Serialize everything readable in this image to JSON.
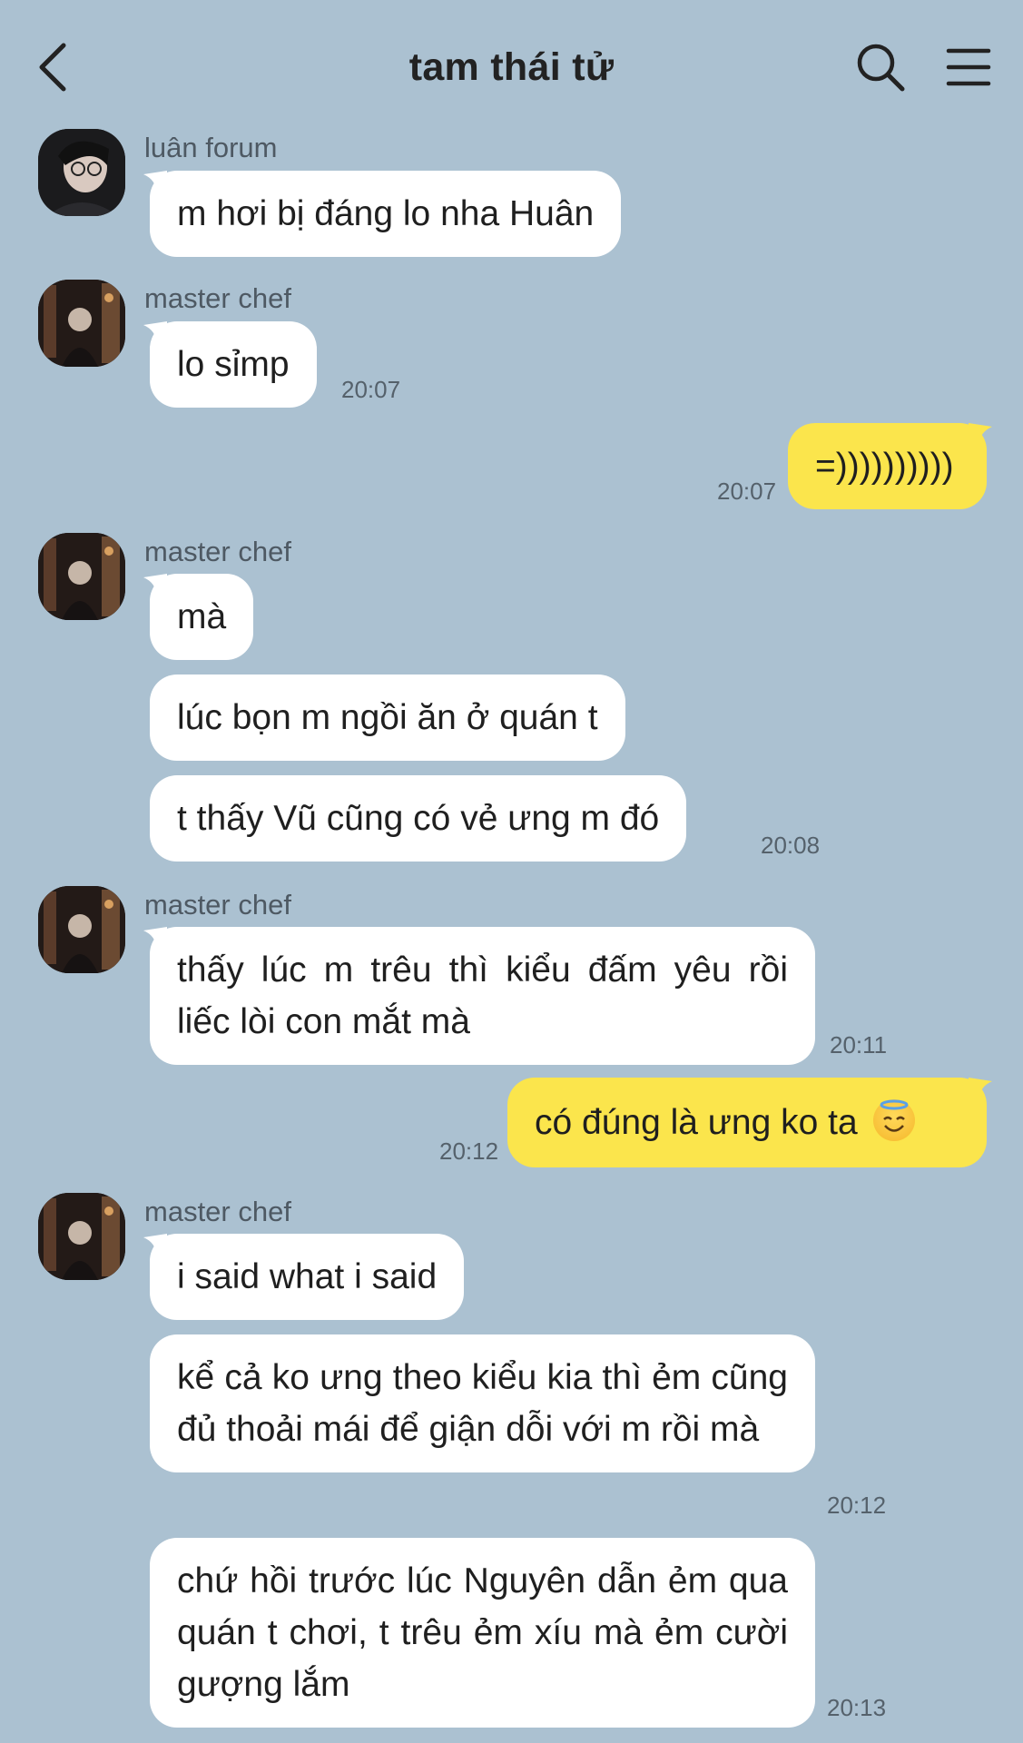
{
  "header": {
    "title": "tam thái tử",
    "back_icon": "chevron-left-icon",
    "search_icon": "search-icon",
    "menu_icon": "hamburger-menu-icon"
  },
  "colors": {
    "background": "#abc1d1",
    "incoming_bubble": "#ffffff",
    "outgoing_bubble": "#fbe54c"
  },
  "messages": [
    {
      "sender": "luân forum",
      "text": "m hơi bị đáng lo nha Huân",
      "time": ""
    },
    {
      "sender": "master chef",
      "text": "lo sỉmp",
      "time": "20:07"
    },
    {
      "sender": "me",
      "text": "=))))))))))",
      "time": "20:07"
    },
    {
      "sender": "master chef",
      "text": "mà",
      "time": ""
    },
    {
      "sender": "master chef",
      "text": "lúc bọn m ngồi ăn ở quán t",
      "time": ""
    },
    {
      "sender": "master chef",
      "text": "t thấy Vũ cũng có vẻ ưng m đó",
      "time": "20:08"
    },
    {
      "sender": "master chef",
      "text": "thấy lúc m trêu thì kiểu đấm yêu rồi liếc lòi con mắt mà",
      "time": "20:11"
    },
    {
      "sender": "me",
      "text": "có đúng là ưng ko ta",
      "emoji": "smiling-face-with-halo-emoji",
      "time": "20:12"
    },
    {
      "sender": "master chef",
      "text": "i said what i said",
      "time": ""
    },
    {
      "sender": "master chef",
      "text": "kể cả ko ưng theo kiểu kia thì ẻm cũng đủ thoải mái để giận dỗi với m rồi mà",
      "time": "20:12"
    },
    {
      "sender": "master chef",
      "text": "chứ hồi trước lúc Nguyên dẫn ẻm qua quán t chơi, t trêu ẻm xíu mà ẻm cười gượng lắm",
      "time": "20:13"
    }
  ]
}
